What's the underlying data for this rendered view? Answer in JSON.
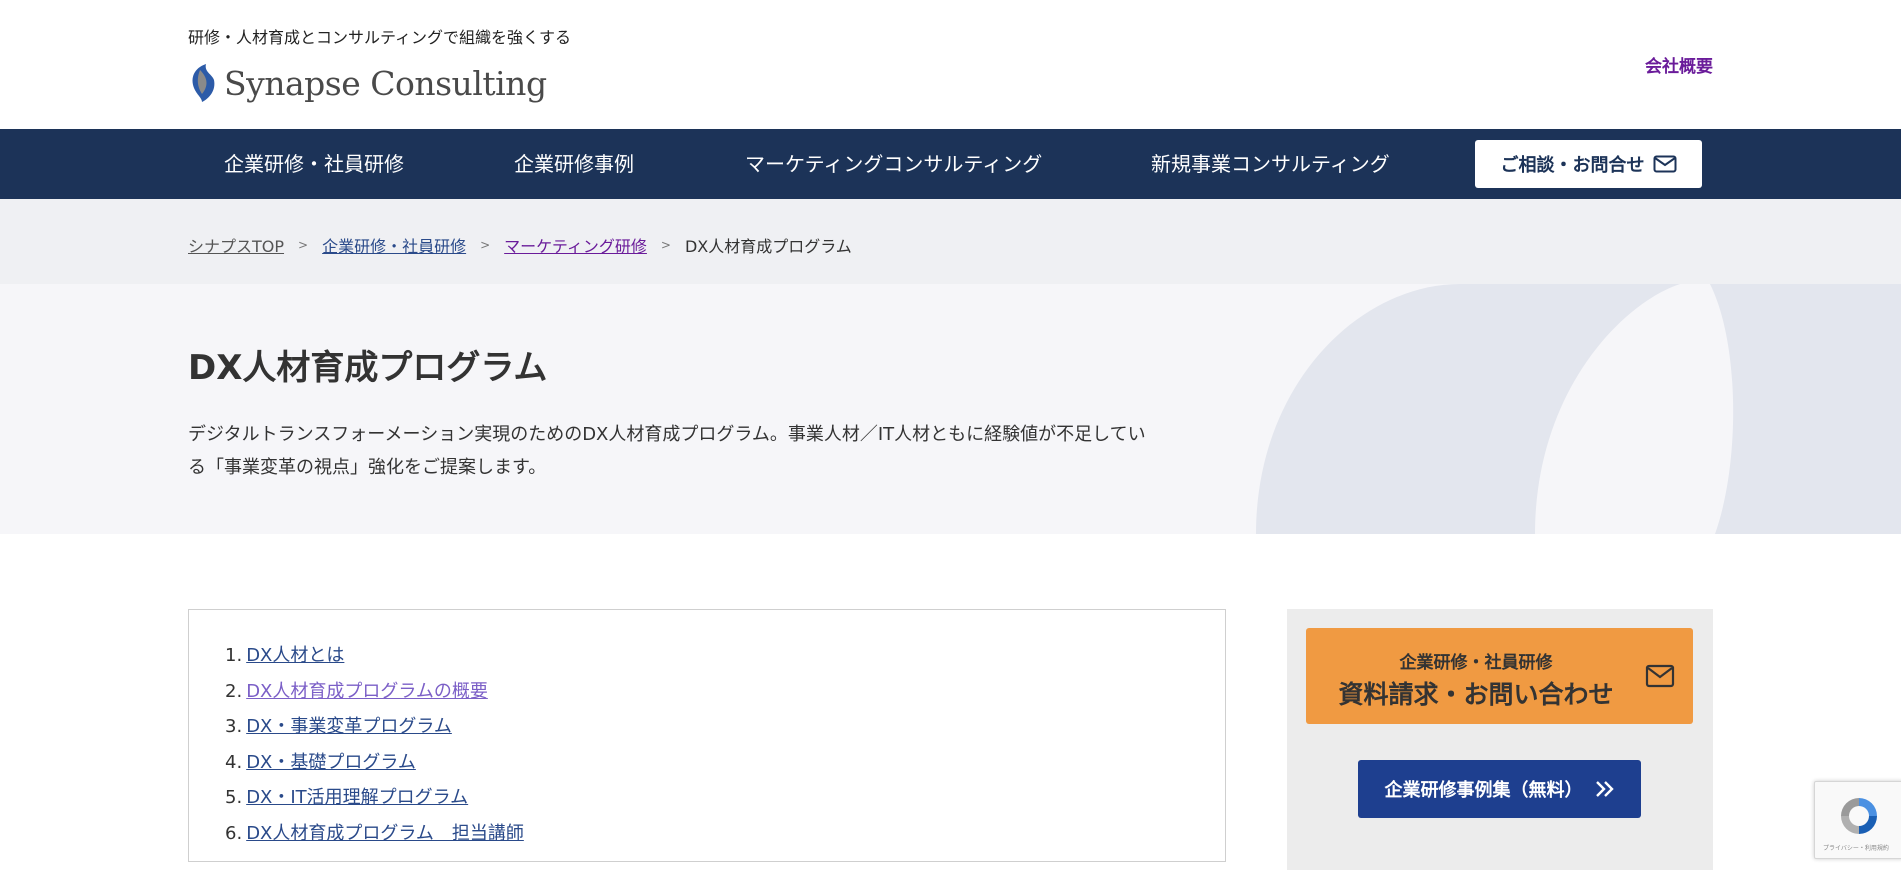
{
  "header": {
    "tagline": "研修・人材育成とコンサルティングで組織を強くする",
    "logo_text": "Synapse Consulting",
    "company_link": "会社概要"
  },
  "nav": {
    "items": [
      "企業研修・社員研修",
      "企業研修事例",
      "マーケティングコンサルティング",
      "新規事業コンサルティング"
    ],
    "contact_button": "ご相談・お問合せ"
  },
  "breadcrumb": {
    "items": [
      "シナプスTOP",
      "企業研修・社員研修",
      "マーケティング研修"
    ],
    "separator": ">",
    "current": "DX人材育成プログラム"
  },
  "hero": {
    "title": "DX人材育成プログラム",
    "description": "デジタルトランスフォーメーション実現のためのDX人材育成プログラム。事業人材／IT人材ともに経験値が不足している「事業変革の視点」強化をご提案します。"
  },
  "toc": {
    "items": [
      {
        "num": "1.",
        "label": "DX人材とは"
      },
      {
        "num": "2.",
        "label": "DX人材育成プログラムの概要"
      },
      {
        "num": "3.",
        "label": "DX・事業変革プログラム"
      },
      {
        "num": "4.",
        "label": "DX・基礎プログラム"
      },
      {
        "num": "5.",
        "label": "DX・IT活用理解プログラム"
      },
      {
        "num": "6.",
        "label": "DX人材育成プログラム　担当講師"
      }
    ]
  },
  "sidebar": {
    "request_sub": "企業研修・社員研修",
    "request_main": "資料請求・お問い合わせ",
    "case_button": "企業研修事例集（無料）"
  },
  "recaptcha": {
    "label": "プライバシー・利用規約"
  },
  "colors": {
    "nav_bg": "#1c3358",
    "request_btn": "#f09a42",
    "case_btn": "#1e3f8f",
    "company_link": "#6a1b9a"
  }
}
